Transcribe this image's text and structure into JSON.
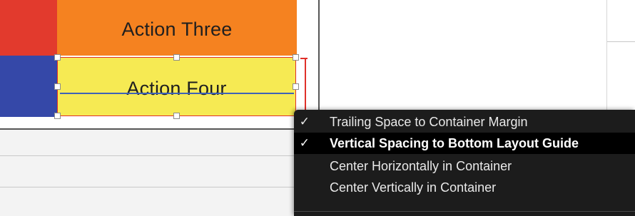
{
  "scene": {
    "blocks": {
      "action_three": "Action Three",
      "action_four": "Action Four"
    },
    "colors": {
      "red": "#e23a2d",
      "blue": "#3548a8",
      "orange": "#f58220",
      "yellow": "#f6ea53",
      "constraint": "#e0302a",
      "baseline": "#3e62b7"
    }
  },
  "context_menu": {
    "items": [
      {
        "label": "Trailing Space to Container Margin",
        "checked": true,
        "check_glyph": "✓"
      },
      {
        "label": "Vertical Spacing to Bottom Layout Guide",
        "checked": true,
        "check_glyph": "✓",
        "highlighted": true
      },
      {
        "label": "Center Horizontally in Container",
        "checked": false
      },
      {
        "label": "Center Vertically in Container",
        "checked": false
      }
    ]
  }
}
